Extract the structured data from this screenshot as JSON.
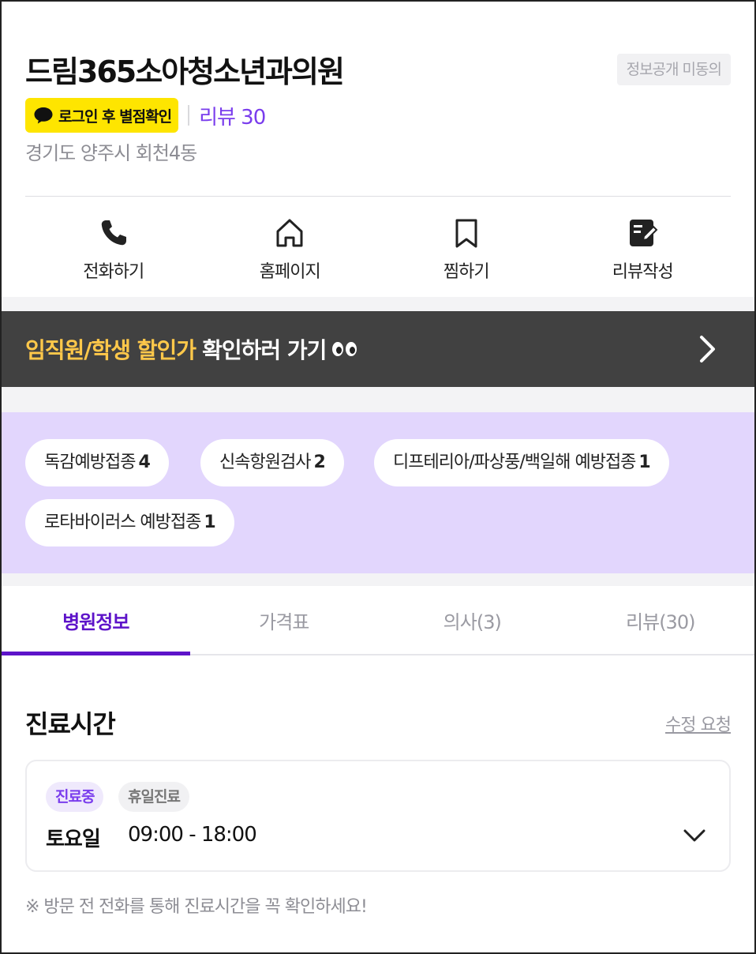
{
  "hospital": {
    "name": "드림365소아청소년과의원",
    "disclosure_label": "정보공개 미동의",
    "kakao_rating_label": "로그인 후 별점확인",
    "review_link": "리뷰 30",
    "address": "경기도 양주시 회천4동"
  },
  "actions": [
    {
      "label": "전화하기",
      "icon": "phone-icon"
    },
    {
      "label": "홈페이지",
      "icon": "home-icon"
    },
    {
      "label": "찜하기",
      "icon": "bookmark-icon"
    },
    {
      "label": "리뷰작성",
      "icon": "edit-note-icon"
    }
  ],
  "promo": {
    "highlight": "임직원/학생 할인가",
    "text": "확인하러 가기",
    "emoji_icon": "eyes-icon"
  },
  "tags": [
    {
      "label": "독감예방접종",
      "count": "4"
    },
    {
      "label": "신속항원검사",
      "count": "2"
    },
    {
      "label": "디프테리아/파상풍/백일해 예방접종",
      "count": "1"
    },
    {
      "label": "로타바이러스 예방접종",
      "count": "1"
    }
  ],
  "tabs": [
    {
      "label": "병원정보",
      "active": true
    },
    {
      "label": "가격표",
      "active": false
    },
    {
      "label": "의사(3)",
      "active": false
    },
    {
      "label": "리뷰(30)",
      "active": false
    }
  ],
  "hours": {
    "title": "진료시간",
    "edit_request": "수정 요청",
    "status_badge": "진료중",
    "holiday_badge": "휴일진료",
    "day": "토요일",
    "time": "09:00 - 18:00",
    "notice": "※ 방문 전 전화를 통해 진료시간을 꼭 확인하세요!"
  },
  "colors": {
    "accent": "#5d13c9",
    "review_purple": "#7a3ded",
    "kakao_yellow": "#fee500",
    "promo_bg": "#414141",
    "promo_highlight": "#ffc84a",
    "tags_bg": "#e2d6fd"
  }
}
